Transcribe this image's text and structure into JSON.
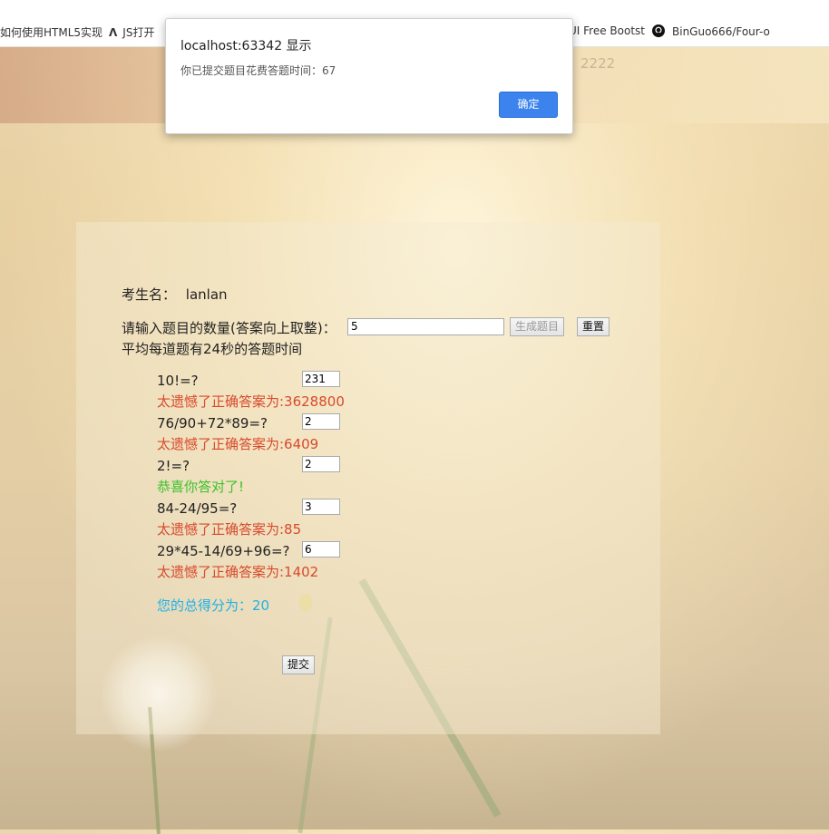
{
  "bookmarks": [
    {
      "label": "如何使用HTML5实现",
      "icon": "page-icon"
    },
    {
      "label": "JS打开",
      "icon": "link-icon"
    },
    {
      "label": "UI Free Bootst",
      "icon": "page-icon"
    },
    {
      "label": "BinGuo666/Four-o",
      "icon": "github-icon"
    }
  ],
  "header": {
    "number": "2222"
  },
  "dialog": {
    "title": "localhost:63342 显示",
    "message": "你已提交题目花费答题时间：67",
    "ok_label": "确定"
  },
  "form": {
    "student_label": "考生名：",
    "student_name": "lanlan",
    "count_prompt": "请输入题目的数量(答案向上取整)：",
    "count_value": "5",
    "generate_label": "生成题目",
    "reset_label": "重置",
    "time_note": "平均每道题有24秒的答题时间"
  },
  "questions": [
    {
      "expr": "10!=?",
      "answer": "231",
      "result": "太遗憾了正确答案为:3628800",
      "correct": false
    },
    {
      "expr": "76/90+72*89=?",
      "answer": "2",
      "result": "太遗憾了正确答案为:6409",
      "correct": false
    },
    {
      "expr": "2!=?",
      "answer": "2",
      "result": "恭喜你答对了!",
      "correct": true
    },
    {
      "expr": "84-24/95=?",
      "answer": "3",
      "result": "太遗憾了正确答案为:85",
      "correct": false
    },
    {
      "expr": "29*45-14/69+96=?",
      "answer": "6",
      "result": "太遗憾了正确答案为:1402",
      "correct": false
    }
  ],
  "score": "您的总得分为：20",
  "submit_label": "提交",
  "colors": {
    "wrong": "#d84a2c",
    "right": "#3cc22a",
    "score": "#1fb2e6",
    "ok_button": "#3c83ee"
  }
}
